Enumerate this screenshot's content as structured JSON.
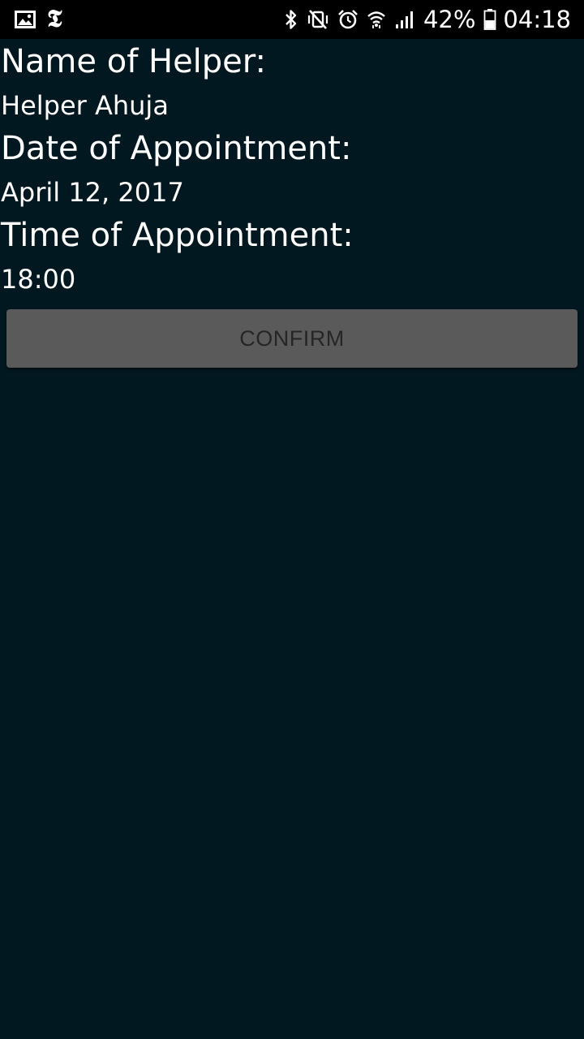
{
  "status_bar": {
    "battery_percent": "42%",
    "time": "04:18",
    "icons": [
      "gallery-icon",
      "nyt-app-icon",
      "bluetooth-icon",
      "vibrate-mute-icon",
      "alarm-icon",
      "wifi-icon",
      "signal-icon",
      "battery-icon"
    ],
    "nyt_glyph": "𝕿"
  },
  "appointment": {
    "helper_label": "Name of Helper:",
    "helper_value": "Helper Ahuja",
    "date_label": "Date of Appointment:",
    "date_value": "April 12, 2017",
    "time_label": "Time of Appointment:",
    "time_value": "18:00"
  },
  "actions": {
    "confirm_label": "CONFIRM"
  },
  "colors": {
    "background": "#021820",
    "status_bar": "#000000",
    "button": "#5a5a5a",
    "button_text": "#262626"
  }
}
